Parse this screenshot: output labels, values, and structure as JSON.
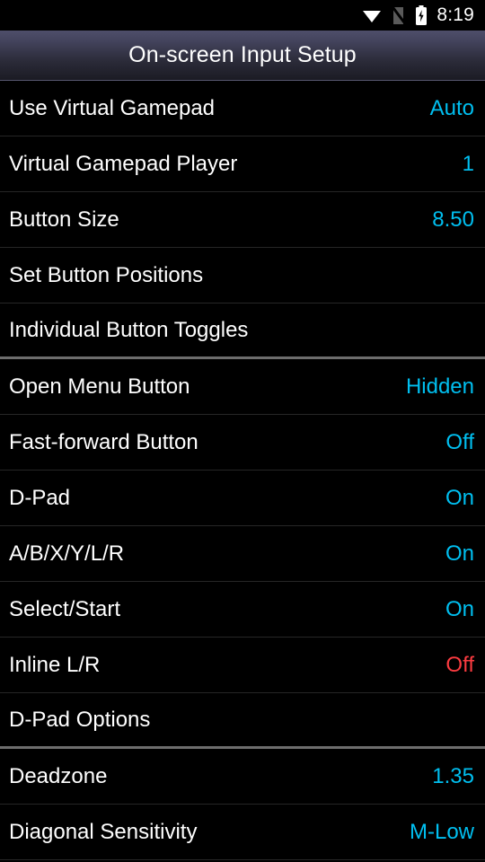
{
  "status_bar": {
    "time": "8:19",
    "icons": [
      {
        "name": "wifi-icon",
        "label": "wifi"
      },
      {
        "name": "no-sim-icon",
        "label": "no-sim"
      },
      {
        "name": "battery-charging-icon",
        "label": "battery-charging"
      }
    ]
  },
  "title_bar": {
    "title": "On-screen Input Setup"
  },
  "colors": {
    "accent": "#00bff0",
    "warn": "#fb3b40",
    "background": "#000000",
    "label": "#ffffff",
    "divider": "#262626",
    "section_divider": "#6d6d6d",
    "titlebar_top": "#4f4f6b",
    "titlebar_bottom": "#1b1b24"
  },
  "settings_list": [
    {
      "label": "Use Virtual Gamepad",
      "value": "Auto",
      "value_style": "accent",
      "section_end": false
    },
    {
      "label": "Virtual Gamepad Player",
      "value": "1",
      "value_style": "accent",
      "section_end": false
    },
    {
      "label": "Button Size",
      "value": "8.50",
      "value_style": "accent",
      "section_end": false
    },
    {
      "label": "Set Button Positions",
      "value": "",
      "value_style": "none",
      "section_end": false
    },
    {
      "label": "Individual Button Toggles",
      "value": "",
      "value_style": "none",
      "section_end": true
    },
    {
      "label": "Open Menu Button",
      "value": "Hidden",
      "value_style": "accent",
      "section_end": false
    },
    {
      "label": "Fast-forward Button",
      "value": "Off",
      "value_style": "accent",
      "section_end": false
    },
    {
      "label": "D-Pad",
      "value": "On",
      "value_style": "accent",
      "section_end": false
    },
    {
      "label": "A/B/X/Y/L/R",
      "value": "On",
      "value_style": "accent",
      "section_end": false
    },
    {
      "label": "Select/Start",
      "value": "On",
      "value_style": "accent",
      "section_end": false
    },
    {
      "label": "Inline L/R",
      "value": "Off",
      "value_style": "warn",
      "section_end": false
    },
    {
      "label": "D-Pad Options",
      "value": "",
      "value_style": "none",
      "section_end": true
    },
    {
      "label": "Deadzone",
      "value": "1.35",
      "value_style": "accent",
      "section_end": false
    },
    {
      "label": "Diagonal Sensitivity",
      "value": "M-Low",
      "value_style": "accent",
      "section_end": false
    }
  ]
}
